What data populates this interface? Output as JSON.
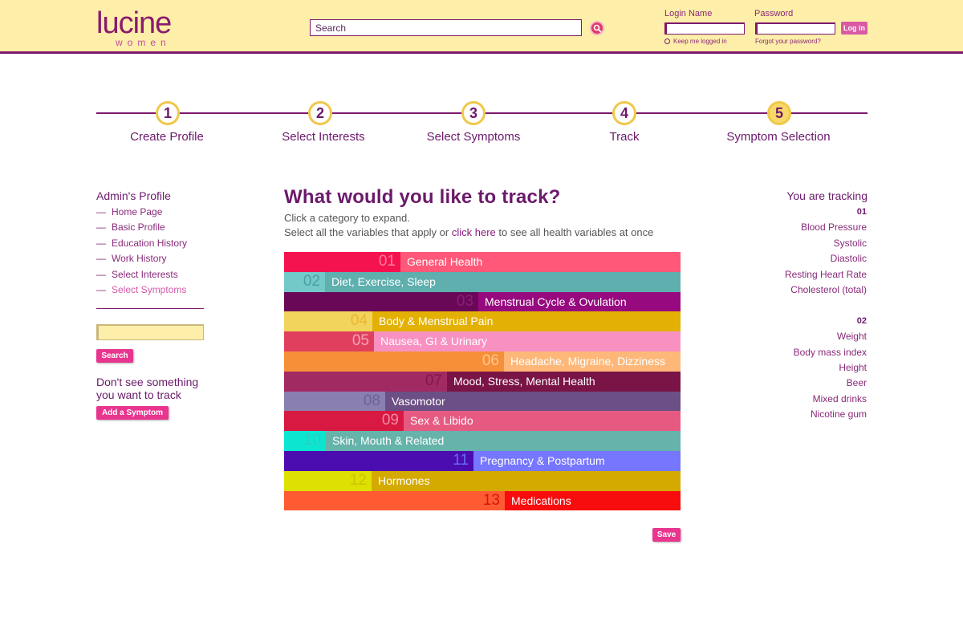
{
  "header": {
    "logo_top": "lucine",
    "logo_bottom": "women",
    "search_placeholder": "Search",
    "login_name_label": "Login Name",
    "password_label": "Password",
    "login_button": "Log in",
    "keep_logged_in": "Keep me logged in",
    "forgot_password": "Forgot your password?"
  },
  "steps": [
    {
      "number": "1",
      "label": "Create Profile"
    },
    {
      "number": "2",
      "label": "Select Interests"
    },
    {
      "number": "3",
      "label": "Select Symptoms"
    },
    {
      "number": "4",
      "label": "Track"
    },
    {
      "number": "5",
      "label": "Symptom Selection"
    }
  ],
  "sidebar": {
    "title": "Admin's Profile",
    "items": [
      {
        "label": "Home Page"
      },
      {
        "label": "Basic Profile"
      },
      {
        "label": "Education History"
      },
      {
        "label": "Work History"
      },
      {
        "label": "Select Interests"
      },
      {
        "label": "Select Symptoms",
        "active": true
      }
    ],
    "dash": "—",
    "search_button": "Search",
    "help_text": "Don't see something you want to track",
    "add_button": "Add a Symptom"
  },
  "main": {
    "title": "What would you like to track?",
    "subtitle1": "Click a category to expand.",
    "subtitle2_before": "Select all the variables that apply or ",
    "subtitle2_link": "click here",
    "subtitle2_after": " to see all health variables at once",
    "save_button": "Save",
    "categories": [
      {
        "num": "01",
        "label": "General Health",
        "num_bg": "#f5134f",
        "lbl_bg": "#ff5878",
        "num_color": "#ff7e98",
        "split": 145
      },
      {
        "num": "02",
        "label": "Diet, Exercise, Sleep",
        "num_bg": "#73c8c8",
        "lbl_bg": "#5eafad",
        "num_color": "#4b9ea3",
        "split": 51
      },
      {
        "num": "03",
        "label": "Menstrual Cycle & Ovulation",
        "num_bg": "#6a0858",
        "lbl_bg": "#97097e",
        "num_color": "#8c1b7a",
        "split": 242
      },
      {
        "num": "04",
        "label": "Body & Menstrual Pain",
        "num_bg": "#f2d35c",
        "lbl_bg": "#e3b104",
        "num_color": "#e8b830",
        "split": 110
      },
      {
        "num": "05",
        "label": "Nausea, GI & Urinary",
        "num_bg": "#e0405e",
        "lbl_bg": "#f891c2",
        "num_color": "#f8a0b8",
        "split": 112
      },
      {
        "num": "06",
        "label": "Headache, Migraine, Dizziness",
        "num_bg": "#f69038",
        "lbl_bg": "#fdb879",
        "num_color": "#ffc690",
        "split": 274
      },
      {
        "num": "07",
        "label": "Mood, Stress, Mental Health",
        "num_bg": "#a22a62",
        "lbl_bg": "#7a1446",
        "num_color": "#7e1a4a",
        "split": 203
      },
      {
        "num": "08",
        "label": "Vasomotor",
        "num_bg": "#8a80b0",
        "lbl_bg": "#6c4f84",
        "num_color": "#6e6294",
        "split": 126
      },
      {
        "num": "09",
        "label": "Sex & Libido",
        "num_bg": "#d81942",
        "lbl_bg": "#e65a82",
        "num_color": "#f08aa6",
        "split": 149
      },
      {
        "num": "10",
        "label": "Skin, Mouth & Related",
        "num_bg": "#0ce6d0",
        "lbl_bg": "#65b3aa",
        "num_color": "#26d0c0",
        "split": 52
      },
      {
        "num": "11",
        "label": "Pregnancy & Postpartum",
        "num_bg": "#4b0db0",
        "lbl_bg": "#7676ff",
        "num_color": "#6a6af0",
        "split": 236
      },
      {
        "num": "12",
        "label": "Hormones",
        "num_bg": "#dee004",
        "lbl_bg": "#d4aa00",
        "num_color": "#cfc200",
        "split": 109
      },
      {
        "num": "13",
        "label": "Medications",
        "num_bg": "#ff5b33",
        "lbl_bg": "#f80d0e",
        "num_color": "#d4140a",
        "split": 275
      }
    ]
  },
  "tracking": {
    "title": "You are tracking",
    "groups": [
      {
        "header": "01",
        "items": [
          "Blood Pressure",
          "Systolic",
          "Diastolic",
          "Resting Heart Rate",
          "Cholesterol (total)"
        ]
      },
      {
        "header": "02",
        "items": [
          "Weight",
          "Body mass index",
          "Height",
          "Beer",
          "Mixed drinks",
          "Nicotine gum"
        ]
      }
    ]
  }
}
